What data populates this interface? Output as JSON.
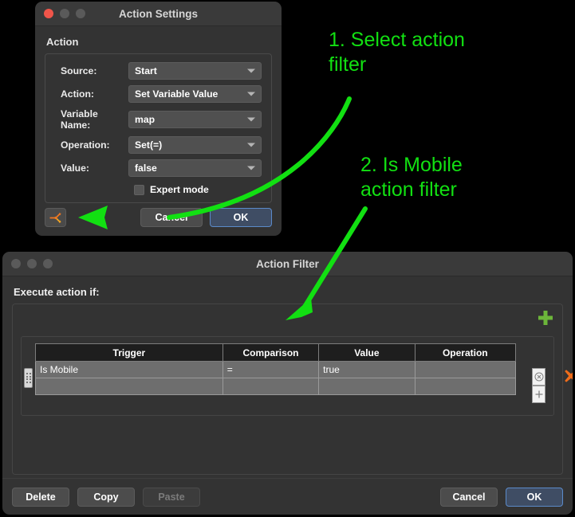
{
  "desktop": {
    "background_color": "#000000"
  },
  "action_settings": {
    "title": "Action Settings",
    "traffic_lights": [
      "close-red",
      "minimize-gray",
      "maximize-gray"
    ],
    "group_label": "Action",
    "fields": [
      {
        "label": "Source:",
        "value": "Start"
      },
      {
        "label": "Action:",
        "value": "Set Variable Value"
      },
      {
        "label": "Variable Name:",
        "value": "map"
      },
      {
        "label": "Operation:",
        "value": "Set(=)"
      },
      {
        "label": "Value:",
        "value": "false"
      }
    ],
    "expert_mode": {
      "label": "Expert mode",
      "checked": false
    },
    "filter_icon": "action-filter-icon",
    "buttons": {
      "cancel": "Cancel",
      "ok": "OK"
    }
  },
  "action_filter": {
    "title": "Action Filter",
    "traffic_lights": [
      "close-gray",
      "minimize-gray",
      "maximize-gray"
    ],
    "execute_label": "Execute action if:",
    "add_button": "add-condition-plus",
    "table": {
      "columns": [
        "Trigger",
        "Comparison",
        "Value",
        "Operation"
      ],
      "rows": [
        {
          "trigger": "Is Mobile",
          "comparison": "=",
          "value": "true",
          "operation": ""
        },
        {
          "trigger": "",
          "comparison": "",
          "value": "",
          "operation": ""
        }
      ]
    },
    "row_clear_icon": "circle-x-icon",
    "row_add_icon": "plus-icon",
    "delete_row_icon": "orange-x-icon",
    "buttons": {
      "delete": "Delete",
      "copy": "Copy",
      "paste": "Paste",
      "cancel": "Cancel",
      "ok": "OK"
    },
    "paste_disabled": true
  },
  "annotations": {
    "color": "#12e012",
    "note1": "1. Select action\nfilter",
    "note2": "2. Is Mobile\naction filter"
  },
  "colors": {
    "accent_green": "#12e012",
    "window_bg": "#333333",
    "titlebar_bg": "#3a3a3a",
    "default_button": "#3f4d64",
    "default_button_border": "#5b8ac9",
    "orange_icon": "#ef7721",
    "green_plus": "#6cb63a"
  }
}
